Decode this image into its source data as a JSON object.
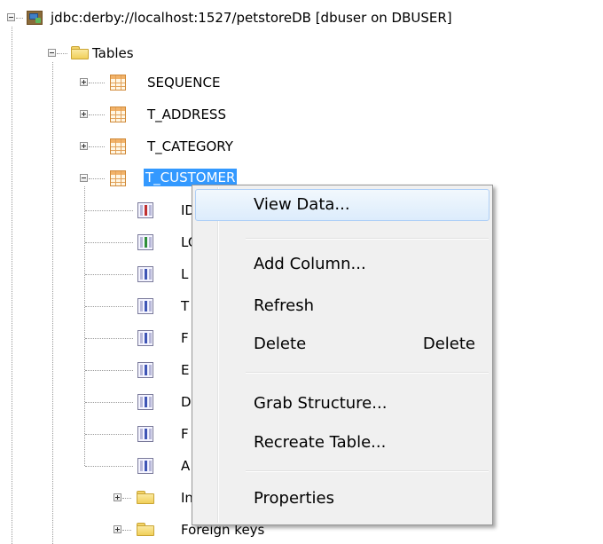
{
  "tree": {
    "connection": {
      "label": "jdbc:derby://localhost:1527/petstoreDB [dbuser on DBUSER]"
    },
    "tables_folder": {
      "label": "Tables"
    },
    "tables": [
      {
        "name": "SEQUENCE",
        "expanded": false
      },
      {
        "name": "T_ADDRESS",
        "expanded": false
      },
      {
        "name": "T_CATEGORY",
        "expanded": false
      },
      {
        "name": "T_CUSTOMER",
        "expanded": true,
        "selected": true
      }
    ],
    "columns": [
      {
        "name": "ID",
        "icon": "primary-key-column-icon"
      },
      {
        "name": "LOGIN",
        "icon": "indexed-column-icon"
      },
      {
        "name": "L",
        "icon": "column-icon"
      },
      {
        "name": "T",
        "icon": "column-icon"
      },
      {
        "name": "F",
        "icon": "column-icon"
      },
      {
        "name": "E",
        "icon": "column-icon"
      },
      {
        "name": "D",
        "icon": "column-icon"
      },
      {
        "name": "F",
        "icon": "column-icon"
      },
      {
        "name": "A",
        "icon": "column-icon"
      }
    ],
    "subfolders": [
      {
        "label": "Indexes"
      },
      {
        "label": "Foreign keys"
      }
    ]
  },
  "context_menu": {
    "items": [
      {
        "label": "View Data...",
        "shortcut": "",
        "highlighted": true
      },
      {
        "label": "Add Column...",
        "shortcut": ""
      },
      {
        "label": "Refresh",
        "shortcut": ""
      },
      {
        "label": "Delete",
        "shortcut": "Delete"
      },
      {
        "label": "Grab Structure...",
        "shortcut": ""
      },
      {
        "label": "Recreate Table...",
        "shortcut": ""
      },
      {
        "label": "Properties",
        "shortcut": ""
      }
    ]
  },
  "colors": {
    "selection": "#3399ff",
    "menu_background": "#f0f0f0",
    "menu_hover_border": "#aecff7"
  }
}
